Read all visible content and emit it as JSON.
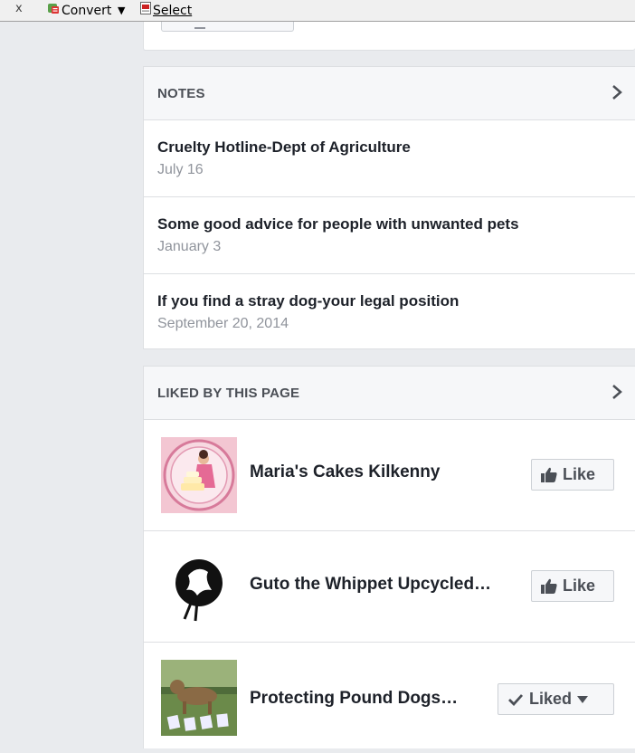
{
  "toolbar": {
    "close_label": "x",
    "convert_label": "Convert",
    "dropdown_arrow": "▼",
    "select_label": "Select"
  },
  "notes": {
    "header": "NOTES",
    "items": [
      {
        "title": "Cruelty Hotline-Dept of Agriculture",
        "date": "July 16"
      },
      {
        "title": "Some good advice for people with unwanted pets",
        "date": "January 3"
      },
      {
        "title": "If you find a stray dog-your legal position",
        "date": "September 20, 2014"
      }
    ]
  },
  "liked": {
    "header": "LIKED BY THIS PAGE",
    "items": [
      {
        "name": "Maria's Cakes Kilkenny",
        "button": "Like"
      },
      {
        "name": "Guto the Whippet Upcycled…",
        "button": "Like"
      },
      {
        "name": "Protecting Pound Dogs…",
        "button": "Liked"
      }
    ]
  },
  "colors": {
    "background": "#e9ebee",
    "card_border": "#dddfe2",
    "text_primary": "#1d2129",
    "text_secondary": "#90949c",
    "header_text": "#4b4f56"
  },
  "icons": [
    "convert-icon",
    "select-icon",
    "chevron-right-icon",
    "thumbs-up-icon",
    "checkmark-icon",
    "caret-down-icon"
  ]
}
